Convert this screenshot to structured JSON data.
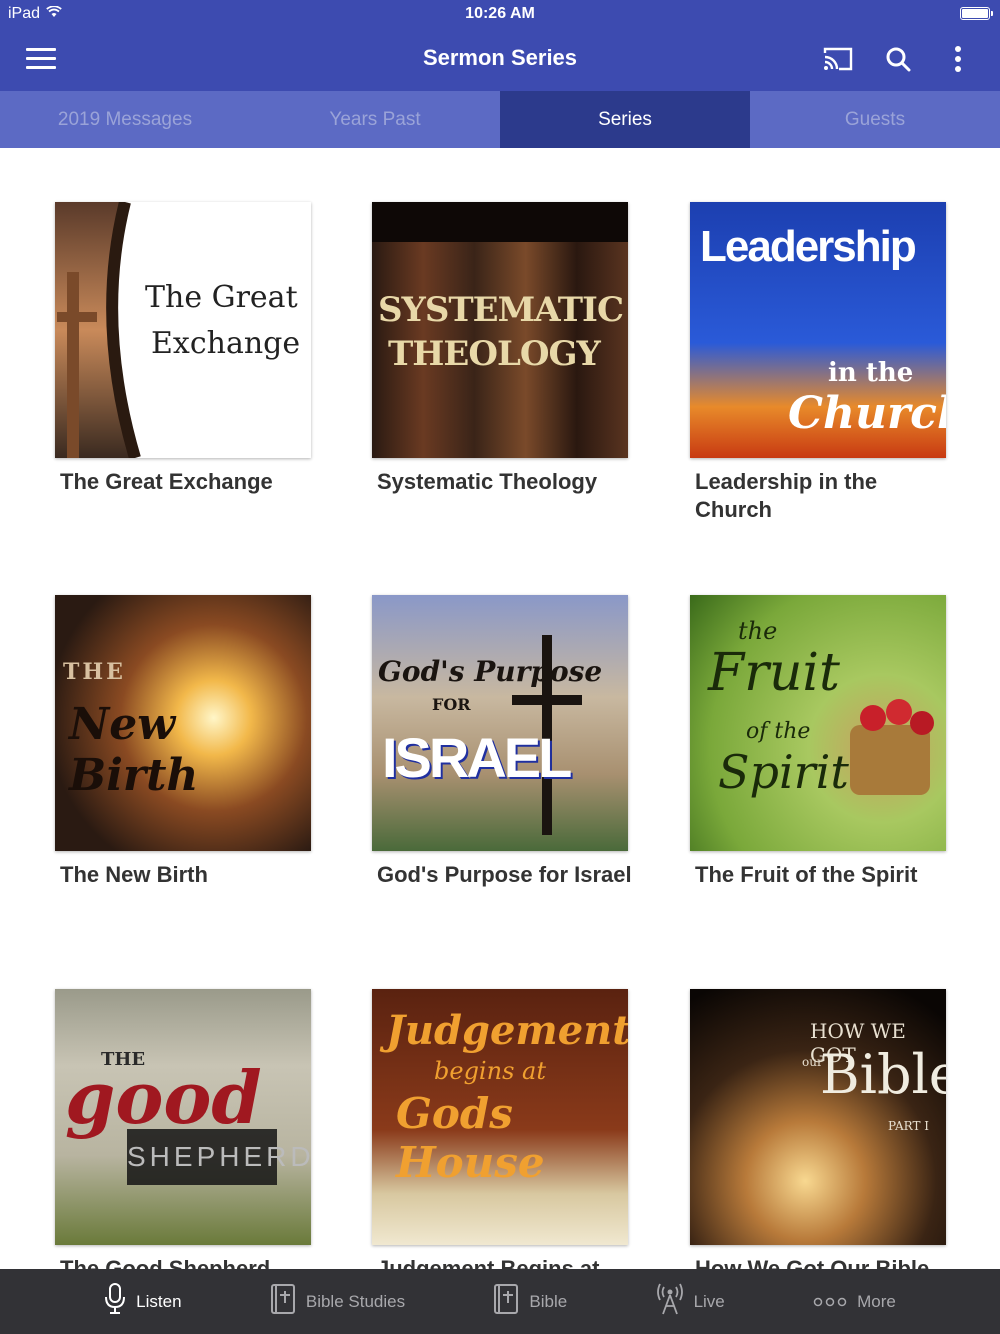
{
  "status": {
    "device": "iPad",
    "time": "10:26 AM"
  },
  "header": {
    "title": "Sermon Series"
  },
  "tabs": [
    {
      "label": "2019 Messages"
    },
    {
      "label": "Years Past"
    },
    {
      "label": "Series"
    },
    {
      "label": "Guests"
    }
  ],
  "series": [
    {
      "title": "The Great Exchange",
      "art_lines": [
        "The Great",
        "Exchange"
      ]
    },
    {
      "title": "Systematic Theology",
      "art_lines": [
        "SYSTEMATIC",
        "THEOLOGY"
      ]
    },
    {
      "title": "Leadership in the Church",
      "art_lines": [
        "Leadership",
        "in the",
        "Church"
      ]
    },
    {
      "title": "The New Birth",
      "art_lines": [
        "THE",
        "New Birth"
      ]
    },
    {
      "title": "God's Purpose for Israel",
      "art_lines": [
        "God's Purpose",
        "FOR",
        "ISRAEL"
      ]
    },
    {
      "title": "The Fruit of the Spirit",
      "art_lines": [
        "the",
        "Fruit",
        "of the",
        "Spirit"
      ]
    },
    {
      "title": "The Good Shepherd",
      "art_lines": [
        "THE",
        "good",
        "SHEPHERD"
      ]
    },
    {
      "title": "Judgement Begins at God's House",
      "art_lines": [
        "Judgement",
        "begins at",
        "Gods House"
      ]
    },
    {
      "title": "How We Got Our Bible",
      "art_lines": [
        "HOW WE GOT",
        "our",
        "Bible",
        "PART I"
      ]
    }
  ],
  "bottom_nav": [
    {
      "label": "Listen",
      "icon": "microphone-icon"
    },
    {
      "label": "Bible Studies",
      "icon": "bible-icon"
    },
    {
      "label": "Bible",
      "icon": "bible-icon"
    },
    {
      "label": "Live",
      "icon": "broadcast-tower-icon"
    },
    {
      "label": "More",
      "icon": "more-dots-icon"
    }
  ]
}
